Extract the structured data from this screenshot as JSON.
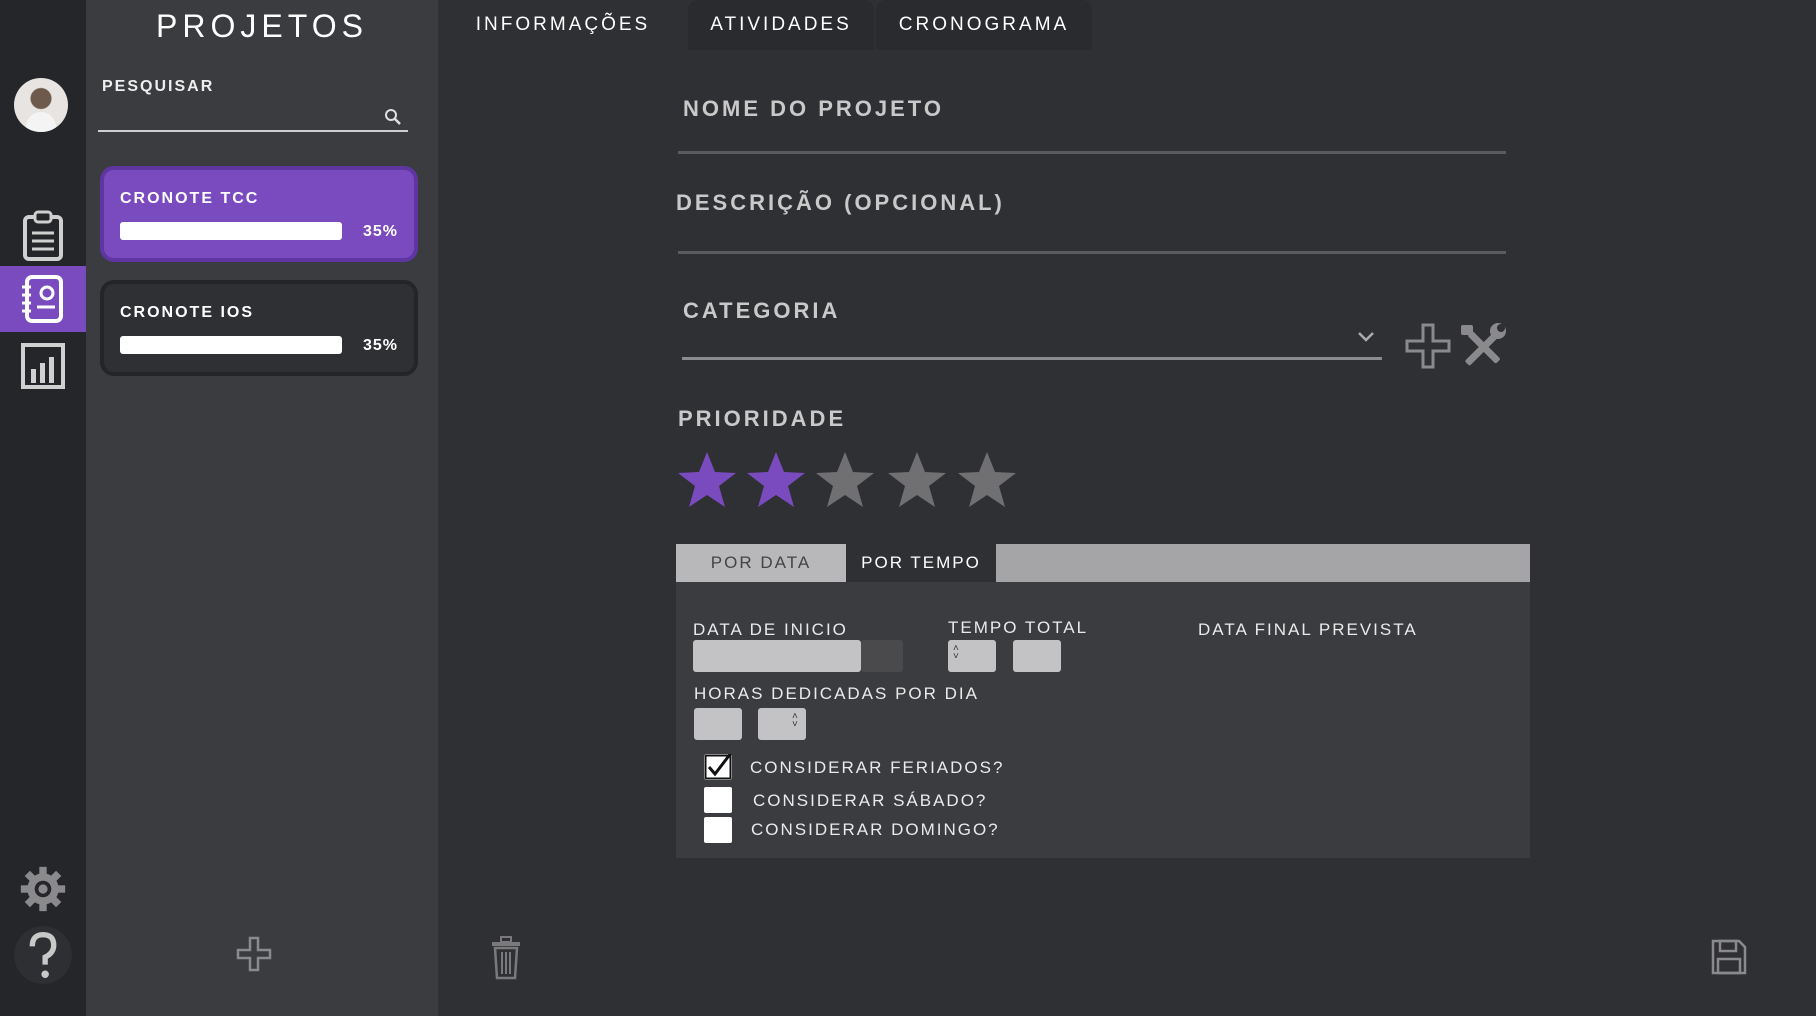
{
  "rail": {
    "items": [
      {
        "icon": "clipboard-icon"
      },
      {
        "icon": "project-notebook-icon",
        "active": true
      },
      {
        "icon": "bar-chart-icon"
      }
    ],
    "bottom": [
      {
        "icon": "gear-icon"
      },
      {
        "icon": "help-icon"
      }
    ]
  },
  "projects": {
    "title": "PROJETOS",
    "search_label": "PESQUISAR",
    "search_value": "",
    "items": [
      {
        "name": "CRONOTE TCC",
        "progress_pct": "35%",
        "progress": 1.0,
        "active": true
      },
      {
        "name": "CRONOTE IOS",
        "progress_pct": "35%",
        "progress": 1.0,
        "active": false
      }
    ]
  },
  "tabs": [
    {
      "label": "INFORMAÇÕES",
      "active": true
    },
    {
      "label": "ATIVIDADES",
      "active": false
    },
    {
      "label": "CRONOGRAMA",
      "active": false
    }
  ],
  "form": {
    "name_label": "NOME DO PROJETO",
    "name_value": "",
    "description_label": "DESCRIÇÃO (OPCIONAL)",
    "description_value": "",
    "category_label": "CATEGORIA",
    "category_value": "",
    "priority_label": "PRIORIDADE",
    "priority_value": 2,
    "priority_max": 5
  },
  "schedule": {
    "tabs": [
      {
        "label": "POR DATA",
        "active": false
      },
      {
        "label": "POR TEMPO",
        "active": true
      }
    ],
    "start_label": "DATA DE INICIO",
    "start_value": "",
    "total_label": "TEMPO TOTAL",
    "final_label": "DATA FINAL PREVISTA",
    "hours_label": "HORAS DEDICADAS POR DIA",
    "checkboxes": [
      {
        "label": "CONSIDERAR FERIADOS?",
        "checked": true
      },
      {
        "label": "CONSIDERAR SÁBADO?",
        "checked": false
      },
      {
        "label": "CONSIDERAR DOMINGO?",
        "checked": false
      }
    ]
  },
  "colors": {
    "accent": "#7a4bbf",
    "star_active": "#7a4bbf",
    "star_inactive": "#707073"
  }
}
